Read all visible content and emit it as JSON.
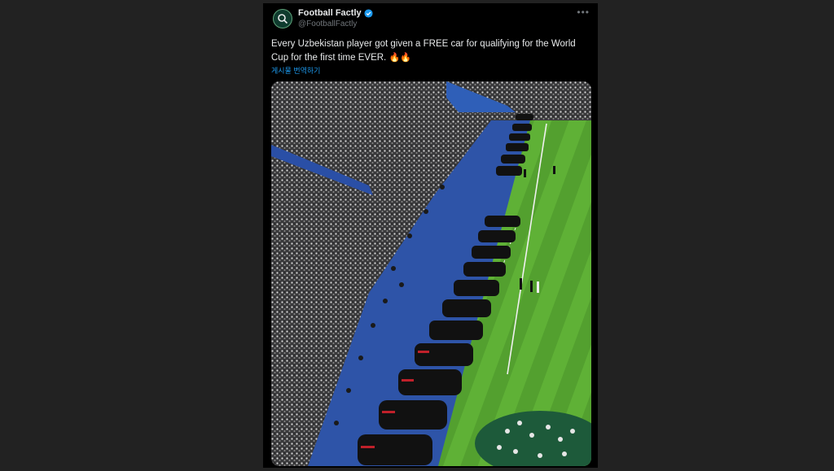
{
  "post": {
    "author_name": "Football Factly",
    "author_handle": "@FootballFactly",
    "verified_icon": "verified-badge-icon",
    "text": "Every Uzbekistan player got given a FREE car for qualifying for the World Cup for the first time EVER.",
    "emojis": "🔥🔥",
    "translate_label": "게시물 번역하기",
    "more_icon": "more-options-icon"
  },
  "colors": {
    "background": "#222222",
    "card": "#000000",
    "text": "#e7e9ea",
    "muted": "#71767b",
    "link": "#1d9bf0",
    "pitch": "#58a832",
    "track": "#2e54a8"
  }
}
